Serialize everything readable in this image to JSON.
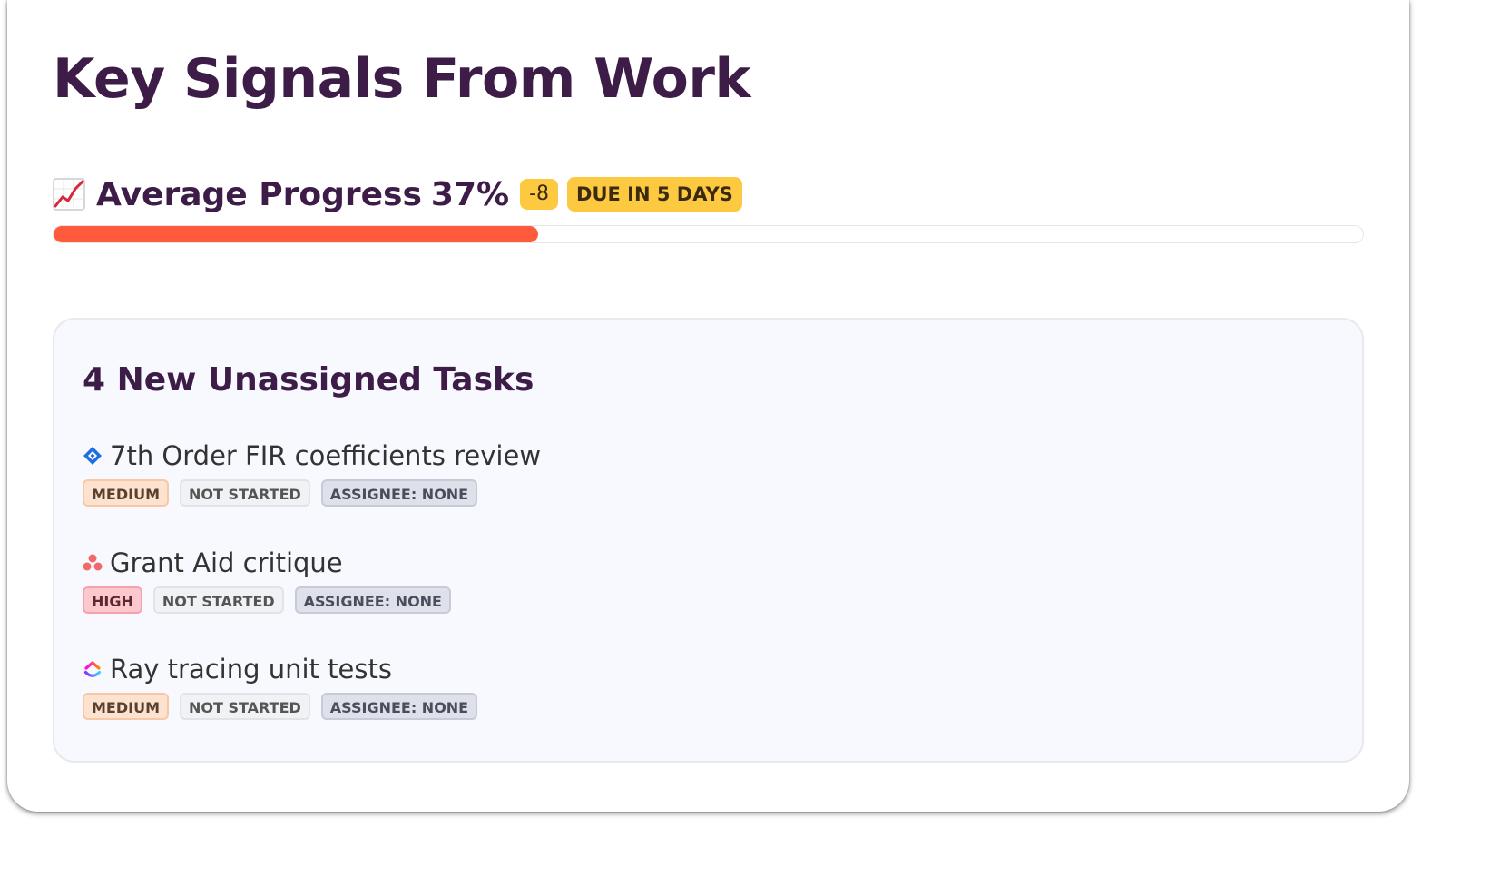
{
  "widget": {
    "title": "Key Signals From Work"
  },
  "progress": {
    "label": "Average Progress",
    "value_text": "37%",
    "value": 0.37,
    "delta": "-8",
    "due": "DUE IN 5 DAYS",
    "fill_color": "#ff5a3c",
    "badge_color": "#fcc940",
    "icon": "chart-increasing-icon"
  },
  "tasks_panel": {
    "title": "4 New Unassigned Tasks",
    "tasks": [
      {
        "name": "7th Order FIR coefficients review",
        "icon": "jira-diamond-icon",
        "priority": "MEDIUM",
        "status": "NOT STARTED",
        "assignee": "ASSIGNEE: NONE"
      },
      {
        "name": "Grant Aid critique",
        "icon": "asana-dots-icon",
        "priority": "HIGH",
        "status": "NOT STARTED",
        "assignee": "ASSIGNEE: NONE"
      },
      {
        "name": "Ray tracing unit tests",
        "icon": "clickup-chevron-icon",
        "priority": "MEDIUM",
        "status": "NOT STARTED",
        "assignee": "ASSIGNEE: NONE"
      }
    ]
  }
}
